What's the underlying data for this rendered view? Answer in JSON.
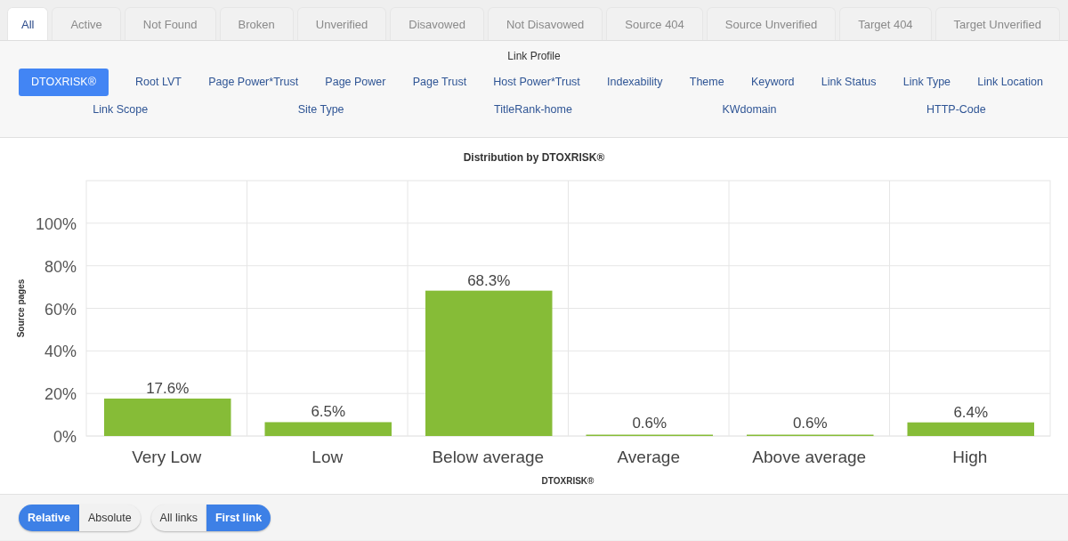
{
  "tabs": [
    {
      "label": "All",
      "selected": true
    },
    {
      "label": "Active",
      "selected": false
    },
    {
      "label": "Not Found",
      "selected": false
    },
    {
      "label": "Broken",
      "selected": false
    },
    {
      "label": "Unverified",
      "selected": false
    },
    {
      "label": "Disavowed",
      "selected": false
    },
    {
      "label": "Not Disavowed",
      "selected": false
    },
    {
      "label": "Source 404",
      "selected": false
    },
    {
      "label": "Source Unverified",
      "selected": false
    },
    {
      "label": "Target 404",
      "selected": false
    },
    {
      "label": "Target Unverified",
      "selected": false
    }
  ],
  "profile": {
    "title": "Link Profile",
    "metric_rows": [
      [
        {
          "label": "DTOXRISK®",
          "selected": true
        },
        {
          "label": "Root LVT",
          "selected": false
        },
        {
          "label": "Page Power*Trust",
          "selected": false
        },
        {
          "label": "Page Power",
          "selected": false
        },
        {
          "label": "Page Trust",
          "selected": false
        },
        {
          "label": "Host Power*Trust",
          "selected": false
        },
        {
          "label": "Indexability",
          "selected": false
        },
        {
          "label": "Theme",
          "selected": false
        },
        {
          "label": "Keyword",
          "selected": false
        },
        {
          "label": "Link Status",
          "selected": false
        },
        {
          "label": "Link Type",
          "selected": false
        },
        {
          "label": "Link Location",
          "selected": false
        }
      ],
      [
        {
          "label": "Link Scope",
          "selected": false
        },
        {
          "label": "Site Type",
          "selected": false
        },
        {
          "label": "TitleRank-home",
          "selected": false
        },
        {
          "label": "KWdomain",
          "selected": false
        },
        {
          "label": "HTTP-Code",
          "selected": false
        }
      ]
    ]
  },
  "chart": {
    "chart_data": {
      "type": "bar",
      "title": "Distribution by DTOXRISK®",
      "xlabel": "DTOXRISK®",
      "ylabel": "Source pages",
      "categories": [
        "Very Low",
        "Low",
        "Below average",
        "Average",
        "Above average",
        "High"
      ],
      "grid": true,
      "series": [
        {
          "color": "#86bc37",
          "values": [
            17.6,
            6.5,
            68.3,
            0.6,
            0.6,
            6.4
          ]
        }
      ],
      "ylim": [
        0,
        120
      ],
      "yticks": [
        {
          "value": 0,
          "label": "0%"
        },
        {
          "value": 20,
          "label": "20%"
        },
        {
          "value": 40,
          "label": "40%"
        },
        {
          "value": 60,
          "label": "60%"
        },
        {
          "value": 80,
          "label": "80%"
        },
        {
          "value": 100,
          "label": "100%"
        }
      ],
      "value_labels": [
        "17.6%",
        "6.5%",
        "68.3%",
        "0.6%",
        "0.6%",
        "6.4%"
      ]
    }
  },
  "toggle_groups": [
    [
      {
        "label": "Relative",
        "selected": true
      },
      {
        "label": "Absolute",
        "selected": false
      }
    ],
    [
      {
        "label": "All links",
        "selected": false
      },
      {
        "label": "First link",
        "selected": true
      }
    ]
  ]
}
